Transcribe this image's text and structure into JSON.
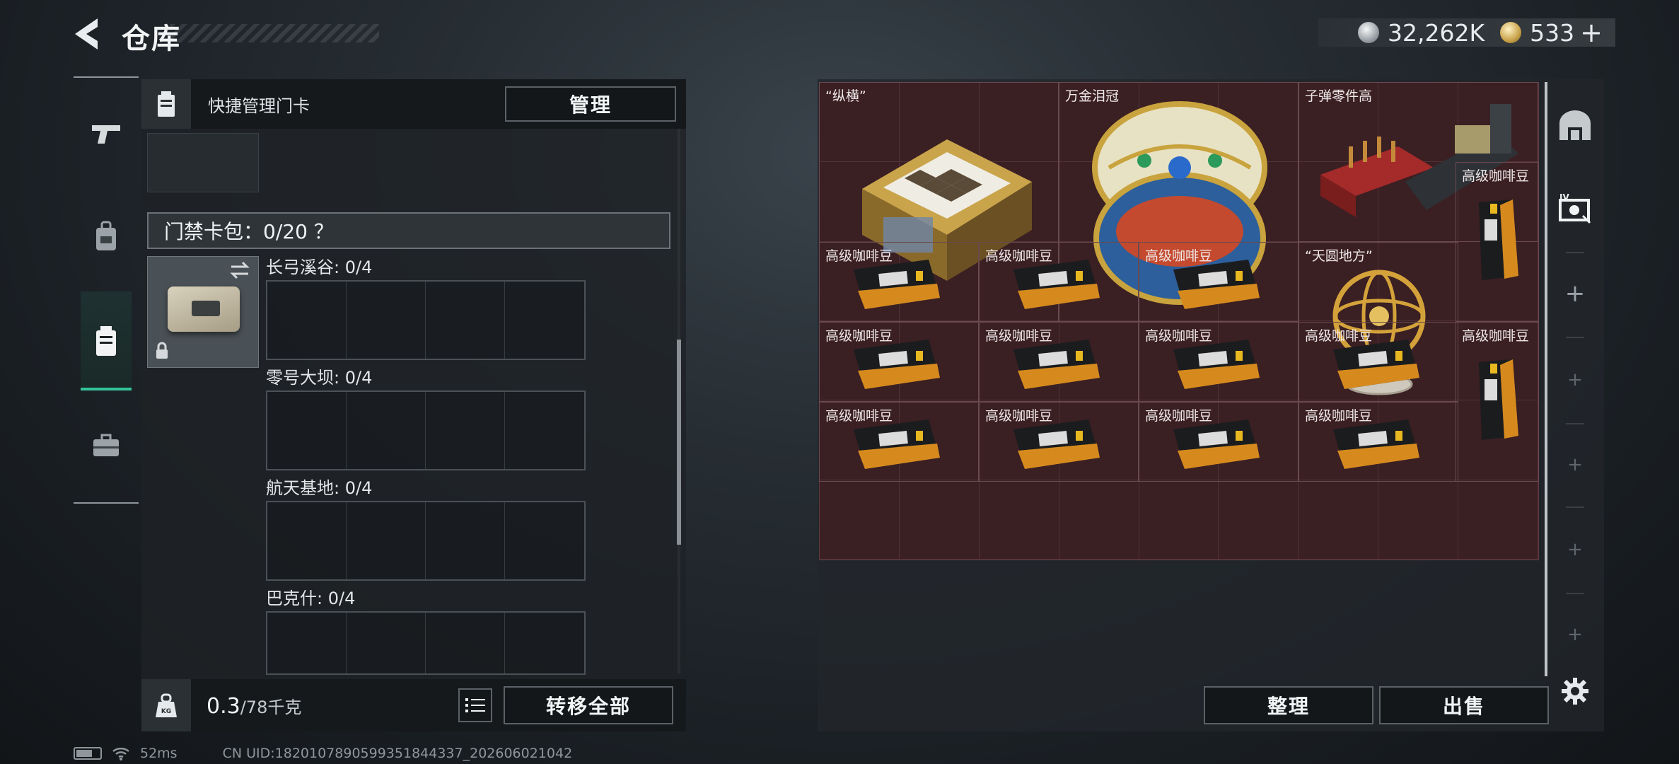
{
  "header": {
    "title": "仓库",
    "currency_silver": "32,262K",
    "currency_gold": "533",
    "plus": "+"
  },
  "left_nav": {
    "items": [
      {
        "name": "weapons",
        "icon": "pistol-icon"
      },
      {
        "name": "equipment",
        "icon": "backpack-icon"
      },
      {
        "name": "keycards",
        "icon": "keycard-case-icon",
        "active": true
      },
      {
        "name": "toolbox",
        "icon": "toolbox-icon"
      }
    ]
  },
  "left_panel": {
    "quick_label": "快捷管理门卡",
    "manage_label": "管理",
    "bag_label": "门禁卡包：0/20 ？",
    "maps": [
      {
        "label": "长弓溪谷: 0/4"
      },
      {
        "label": "零号大坝: 0/4"
      },
      {
        "label": "航天基地: 0/4"
      },
      {
        "label": "巴克什: 0/4"
      }
    ],
    "weight_value": "0.3",
    "weight_capacity": "/78千克",
    "transfer_label": "转移全部"
  },
  "right_panel": {
    "items": [
      {
        "name": "“纵横”",
        "kind": "chessboard"
      },
      {
        "name": "万金泪冠",
        "kind": "egg"
      },
      {
        "name": "子弹零件高",
        "kind": "bullets"
      },
      {
        "name": "“天圆地方”",
        "kind": "globe"
      },
      {
        "name": "高级咖啡豆",
        "kind": "coffee"
      }
    ],
    "tidy_label": "整理",
    "sell_label": "出售"
  },
  "status": {
    "ping": "52ms",
    "uid": "CN UID:1820107890599351844337_202606021042"
  },
  "colors": {
    "accent": "#33c49a",
    "grid_bg": "#3a1f23"
  }
}
